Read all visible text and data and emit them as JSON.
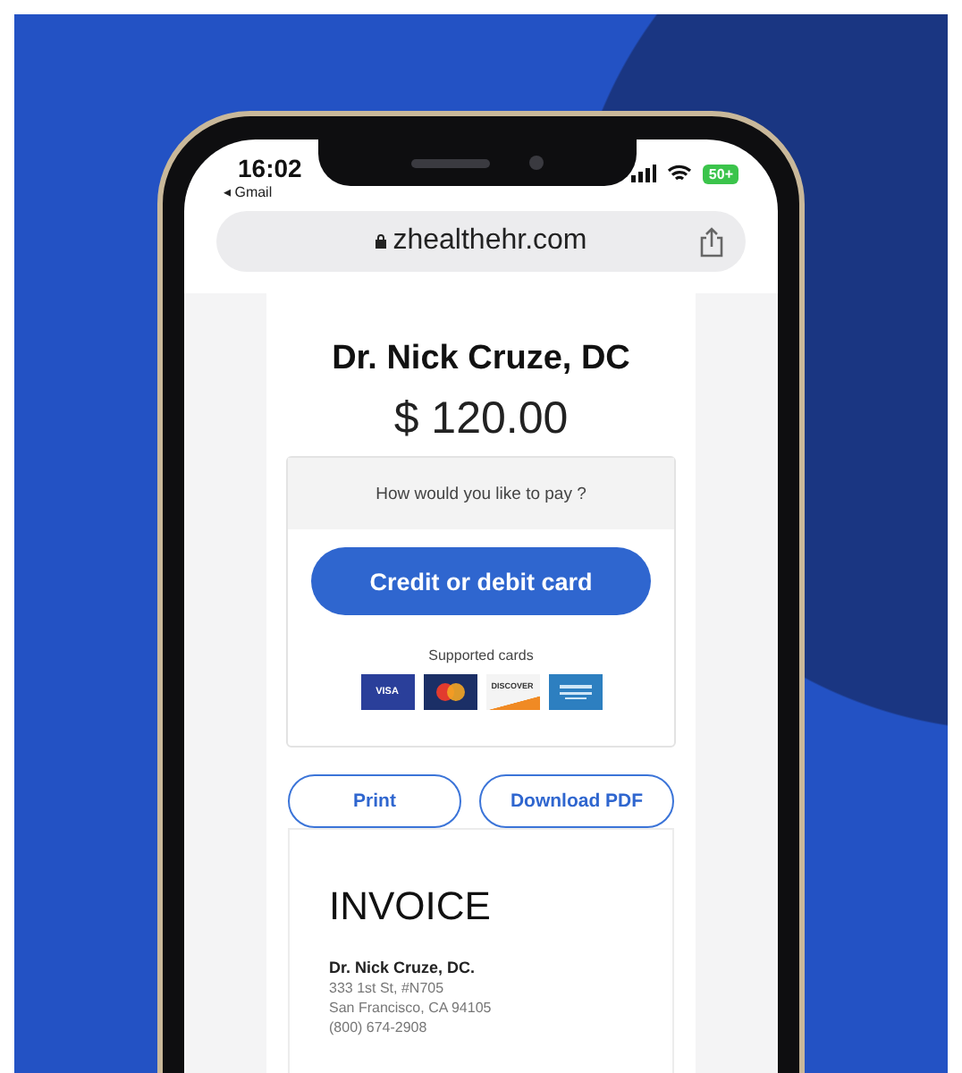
{
  "status_bar": {
    "time": "16:02",
    "back_link": "◂ Gmail",
    "battery": "50+"
  },
  "browser": {
    "url": "zhealthehr.com"
  },
  "payment": {
    "provider": "Dr. Nick Cruze, DC",
    "amount": "$ 120.00",
    "prompt": "How would you like to pay ?",
    "pay_button": "Credit or debit card",
    "supported_label": "Supported cards",
    "cards": [
      {
        "kind": "visa",
        "label": "VISA"
      },
      {
        "kind": "mastercard"
      },
      {
        "kind": "discover",
        "label": "DISCOVER"
      },
      {
        "kind": "amex"
      }
    ]
  },
  "actions": [
    "Print",
    "Download PDF"
  ],
  "invoice": {
    "title": "INVOICE",
    "name": "Dr. Nick Cruze, DC.",
    "address_lines": [
      "333 1st St, #N705",
      "San Francisco, CA 94105",
      "(800) 674-2908"
    ]
  }
}
